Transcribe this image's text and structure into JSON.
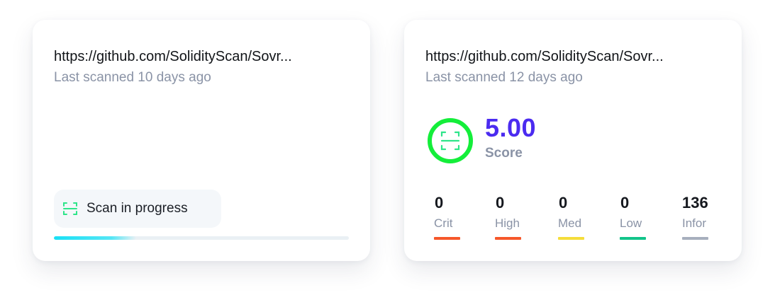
{
  "cards": [
    {
      "url": "https://github.com/SolidityScan/Sovr...",
      "last_scanned": "Last scanned 10 days ago",
      "status_label": "Scan in progress",
      "progress_fraction": 0.28,
      "scan_icon": "scan-frame-icon",
      "scan_icon_color": "#2ee58a"
    },
    {
      "url": "https://github.com/SolidityScan/Sovr...",
      "last_scanned": "Last scanned 12 days ago",
      "score": {
        "value": "5.00",
        "label": "Score",
        "ring_color": "#14ee3a",
        "value_color": "#4b2bf0",
        "icon": "scan-frame-icon"
      },
      "severities": [
        {
          "count": "0",
          "label": "Crit",
          "color": "#f6572a"
        },
        {
          "count": "0",
          "label": "High",
          "color": "#f6572a"
        },
        {
          "count": "0",
          "label": "Med",
          "color": "#f5dd3a"
        },
        {
          "count": "0",
          "label": "Low",
          "color": "#12c48a"
        },
        {
          "count": "136",
          "label": "Infor",
          "color": "#a7afbd"
        }
      ]
    }
  ]
}
